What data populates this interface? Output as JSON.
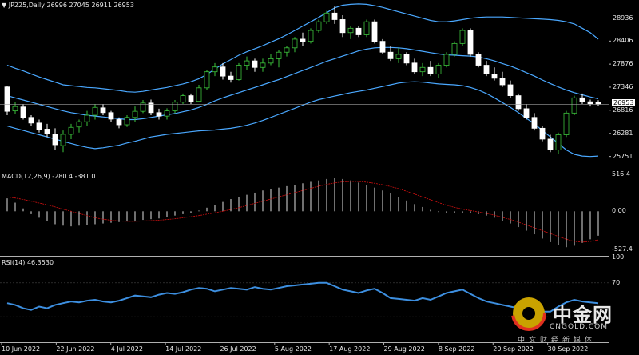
{
  "header": {
    "symbol": "JP225,Daily",
    "ohlc": "26996 27045 26911 26953",
    "macd_label": "MACD(12,26,9) -280.4 -381.0",
    "rsi_label": "RSI(14) 46.3530"
  },
  "watermark": {
    "name": "中金网",
    "url": "CNGOLD.COM",
    "tagline": "中文财经新媒体"
  },
  "colors": {
    "background": "#000000",
    "bull_candle": "#000000",
    "bull_outline": "#3cc43c",
    "bear_candle": "#ffffff",
    "bollinger": "#4aa8ff",
    "macd_hist": "#cccccc",
    "macd_signal": "#d01010",
    "rsi_line": "#3d8fe0",
    "grid": "#444444",
    "price_line": "#a0a0a0"
  },
  "chart_data": [
    {
      "type": "candlestick",
      "name": "JP225",
      "ylim": [
        25450,
        29350
      ],
      "y_ticks": [
        28936,
        28406,
        27876,
        27346,
        26816,
        26281,
        25751
      ],
      "current_price": 26953,
      "x_ticks": [
        "10 Jun 2022",
        "22 Jun 2022",
        "4 Jul 2022",
        "14 Jul 2022",
        "26 Jul 2022",
        "5 Aug 2022",
        "17 Aug 2022",
        "29 Aug 2022",
        "8 Sep 2022",
        "20 Sep 2022",
        "30 Sep 2022"
      ],
      "candles": [
        [
          27350,
          27380,
          26700,
          26790
        ],
        [
          26800,
          27000,
          26720,
          26900
        ],
        [
          26890,
          26950,
          26600,
          26650
        ],
        [
          26650,
          26700,
          26450,
          26520
        ],
        [
          26520,
          26600,
          26300,
          26370
        ],
        [
          26380,
          26500,
          26200,
          26280
        ],
        [
          26270,
          26400,
          25900,
          26020
        ],
        [
          26000,
          26350,
          25850,
          26260
        ],
        [
          26260,
          26500,
          26150,
          26420
        ],
        [
          26430,
          26600,
          26300,
          26550
        ],
        [
          26550,
          26800,
          26450,
          26700
        ],
        [
          26700,
          26950,
          26600,
          26880
        ],
        [
          26870,
          26950,
          26700,
          26760
        ],
        [
          26760,
          26800,
          26550,
          26610
        ],
        [
          26600,
          26650,
          26400,
          26480
        ],
        [
          26480,
          26700,
          26430,
          26650
        ],
        [
          26650,
          26900,
          26550,
          26790
        ],
        [
          26790,
          27050,
          26750,
          26980
        ],
        [
          26980,
          27060,
          26700,
          26760
        ],
        [
          26760,
          26850,
          26600,
          26680
        ],
        [
          26680,
          26860,
          26600,
          26800
        ],
        [
          26800,
          27050,
          26750,
          27000
        ],
        [
          27000,
          27200,
          26950,
          27150
        ],
        [
          27150,
          27200,
          26950,
          27020
        ],
        [
          27020,
          27400,
          27000,
          27330
        ],
        [
          27330,
          27750,
          27280,
          27700
        ],
        [
          27700,
          27900,
          27600,
          27810
        ],
        [
          27810,
          27900,
          27520,
          27600
        ],
        [
          27600,
          27700,
          27450,
          27520
        ],
        [
          27520,
          27900,
          27500,
          27850
        ],
        [
          27850,
          28050,
          27750,
          27950
        ],
        [
          27950,
          28000,
          27700,
          27800
        ],
        [
          27800,
          28000,
          27700,
          27900
        ],
        [
          27900,
          28100,
          27850,
          28000
        ],
        [
          28000,
          28200,
          27800,
          28150
        ],
        [
          28150,
          28300,
          28050,
          28250
        ],
        [
          28250,
          28500,
          28150,
          28450
        ],
        [
          28450,
          28600,
          28300,
          28400
        ],
        [
          28400,
          28700,
          28350,
          28650
        ],
        [
          28650,
          28900,
          28600,
          28850
        ],
        [
          28850,
          29100,
          28800,
          29050
        ],
        [
          29050,
          29200,
          28800,
          28900
        ],
        [
          28900,
          29000,
          28500,
          28600
        ],
        [
          28600,
          28750,
          28450,
          28700
        ],
        [
          28700,
          28750,
          28500,
          28550
        ],
        [
          28550,
          28900,
          28500,
          28850
        ],
        [
          28850,
          28900,
          28350,
          28400
        ],
        [
          28400,
          28450,
          28100,
          28150
        ],
        [
          28150,
          28300,
          27950,
          28000
        ],
        [
          28000,
          28250,
          27900,
          28100
        ],
        [
          28100,
          28150,
          27850,
          27900
        ],
        [
          27900,
          28000,
          27650,
          27700
        ],
        [
          27700,
          27900,
          27600,
          27800
        ],
        [
          27800,
          27950,
          27600,
          27650
        ],
        [
          27650,
          27900,
          27550,
          27850
        ],
        [
          27850,
          28150,
          27800,
          28100
        ],
        [
          28100,
          28400,
          28050,
          28350
        ],
        [
          28350,
          28700,
          28300,
          28650
        ],
        [
          28650,
          28700,
          28050,
          28100
        ],
        [
          28100,
          28150,
          27800,
          27850
        ],
        [
          27850,
          27950,
          27600,
          27650
        ],
        [
          27650,
          27800,
          27500,
          27550
        ],
        [
          27550,
          27700,
          27350,
          27400
        ],
        [
          27400,
          27500,
          27100,
          27150
        ],
        [
          27150,
          27200,
          26800,
          26850
        ],
        [
          26850,
          26950,
          26600,
          26650
        ],
        [
          26650,
          26750,
          26350,
          26400
        ],
        [
          26400,
          26450,
          26100,
          26150
        ],
        [
          26150,
          26250,
          25850,
          25900
        ],
        [
          25900,
          26300,
          25800,
          26250
        ],
        [
          26250,
          26800,
          26200,
          26750
        ],
        [
          26750,
          27150,
          26700,
          27100
        ],
        [
          27100,
          27200,
          26950,
          27010
        ],
        [
          27010,
          27060,
          26900,
          26960
        ],
        [
          26996,
          27045,
          26911,
          26953
        ]
      ],
      "bollinger_upper": [
        27850,
        27780,
        27720,
        27650,
        27580,
        27520,
        27460,
        27400,
        27380,
        27360,
        27340,
        27330,
        27310,
        27290,
        27270,
        27240,
        27230,
        27250,
        27280,
        27310,
        27340,
        27380,
        27420,
        27470,
        27540,
        27640,
        27760,
        27880,
        27980,
        28080,
        28160,
        28230,
        28300,
        28380,
        28460,
        28550,
        28650,
        28750,
        28850,
        28950,
        29060,
        29170,
        29230,
        29250,
        29260,
        29250,
        29220,
        29180,
        29130,
        29080,
        29030,
        28980,
        28930,
        28880,
        28850,
        28850,
        28870,
        28900,
        28930,
        28950,
        28960,
        28960,
        28960,
        28950,
        28940,
        28930,
        28920,
        28910,
        28900,
        28880,
        28850,
        28800,
        28700,
        28600,
        28450
      ],
      "bollinger_mid": [
        27150,
        27100,
        27050,
        27000,
        26950,
        26900,
        26850,
        26800,
        26760,
        26730,
        26700,
        26680,
        26660,
        26640,
        26620,
        26600,
        26600,
        26620,
        26650,
        26680,
        26710,
        26740,
        26780,
        26820,
        26880,
        26950,
        27030,
        27100,
        27160,
        27220,
        27280,
        27340,
        27400,
        27460,
        27520,
        27590,
        27660,
        27730,
        27800,
        27870,
        27940,
        28000,
        28060,
        28120,
        28180,
        28220,
        28250,
        28260,
        28260,
        28250,
        28230,
        28200,
        28170,
        28140,
        28110,
        28090,
        28080,
        28070,
        28060,
        28040,
        28000,
        27950,
        27890,
        27830,
        27760,
        27680,
        27600,
        27510,
        27430,
        27350,
        27280,
        27220,
        27170,
        27120,
        27080
      ],
      "bollinger_lower": [
        26450,
        26400,
        26350,
        26300,
        26250,
        26200,
        26150,
        26100,
        26050,
        26000,
        25960,
        25930,
        25950,
        25980,
        26010,
        26060,
        26100,
        26150,
        26200,
        26230,
        26260,
        26280,
        26300,
        26320,
        26340,
        26350,
        26360,
        26380,
        26400,
        26430,
        26470,
        26520,
        26580,
        26650,
        26720,
        26790,
        26860,
        26930,
        27000,
        27060,
        27100,
        27140,
        27180,
        27220,
        27250,
        27280,
        27320,
        27360,
        27400,
        27440,
        27460,
        27470,
        27460,
        27440,
        27420,
        27410,
        27400,
        27380,
        27340,
        27280,
        27200,
        27100,
        26990,
        26880,
        26760,
        26630,
        26500,
        26350,
        26200,
        26050,
        25900,
        25800,
        25760,
        25750,
        25760
      ]
    },
    {
      "type": "bar",
      "name": "MACD(12,26,9)",
      "ylim": [
        -620,
        560
      ],
      "y_ticks": [
        516.4,
        0.0,
        -527.4
      ],
      "values": [
        180,
        120,
        40,
        -40,
        -90,
        -140,
        -180,
        -200,
        -210,
        -200,
        -190,
        -180,
        -170,
        -160,
        -150,
        -140,
        -130,
        -120,
        -110,
        -100,
        -80,
        -60,
        -40,
        -20,
        10,
        50,
        90,
        130,
        170,
        200,
        230,
        260,
        290,
        310,
        330,
        350,
        370,
        390,
        410,
        430,
        450,
        460,
        450,
        430,
        400,
        370,
        330,
        290,
        250,
        200,
        150,
        100,
        60,
        20,
        -10,
        -20,
        -20,
        -20,
        -30,
        -40,
        -60,
        -90,
        -130,
        -170,
        -220,
        -270,
        -320,
        -380,
        -430,
        -470,
        -500,
        -480,
        -440,
        -390,
        -340
      ],
      "signal": [
        200,
        185,
        165,
        140,
        115,
        90,
        60,
        30,
        0,
        -30,
        -60,
        -90,
        -110,
        -125,
        -135,
        -140,
        -140,
        -135,
        -130,
        -125,
        -115,
        -105,
        -90,
        -75,
        -60,
        -40,
        -20,
        0,
        25,
        50,
        80,
        110,
        140,
        170,
        200,
        230,
        260,
        290,
        320,
        350,
        375,
        395,
        410,
        415,
        415,
        405,
        390,
        370,
        345,
        315,
        280,
        240,
        200,
        160,
        120,
        85,
        55,
        30,
        10,
        -10,
        -30,
        -55,
        -85,
        -115,
        -150,
        -190,
        -230,
        -270,
        -310,
        -350,
        -390,
        -420,
        -430,
        -420,
        -400
      ]
    },
    {
      "type": "line",
      "name": "RSI(14)",
      "ylim": [
        0,
        100
      ],
      "y_ticks": [
        100,
        70
      ],
      "values": [
        46,
        44,
        40,
        38,
        42,
        40,
        44,
        46,
        48,
        47,
        49,
        50,
        48,
        47,
        49,
        52,
        55,
        54,
        53,
        56,
        58,
        57,
        59,
        62,
        64,
        63,
        60,
        62,
        64,
        63,
        62,
        65,
        63,
        62,
        64,
        66,
        67,
        68,
        69,
        70,
        70,
        66,
        62,
        60,
        58,
        61,
        63,
        58,
        52,
        51,
        50,
        49,
        52,
        50,
        54,
        58,
        60,
        62,
        57,
        52,
        48,
        46,
        44,
        42,
        40,
        38,
        38,
        36,
        36,
        42,
        47,
        50,
        48,
        47,
        46
      ]
    }
  ]
}
